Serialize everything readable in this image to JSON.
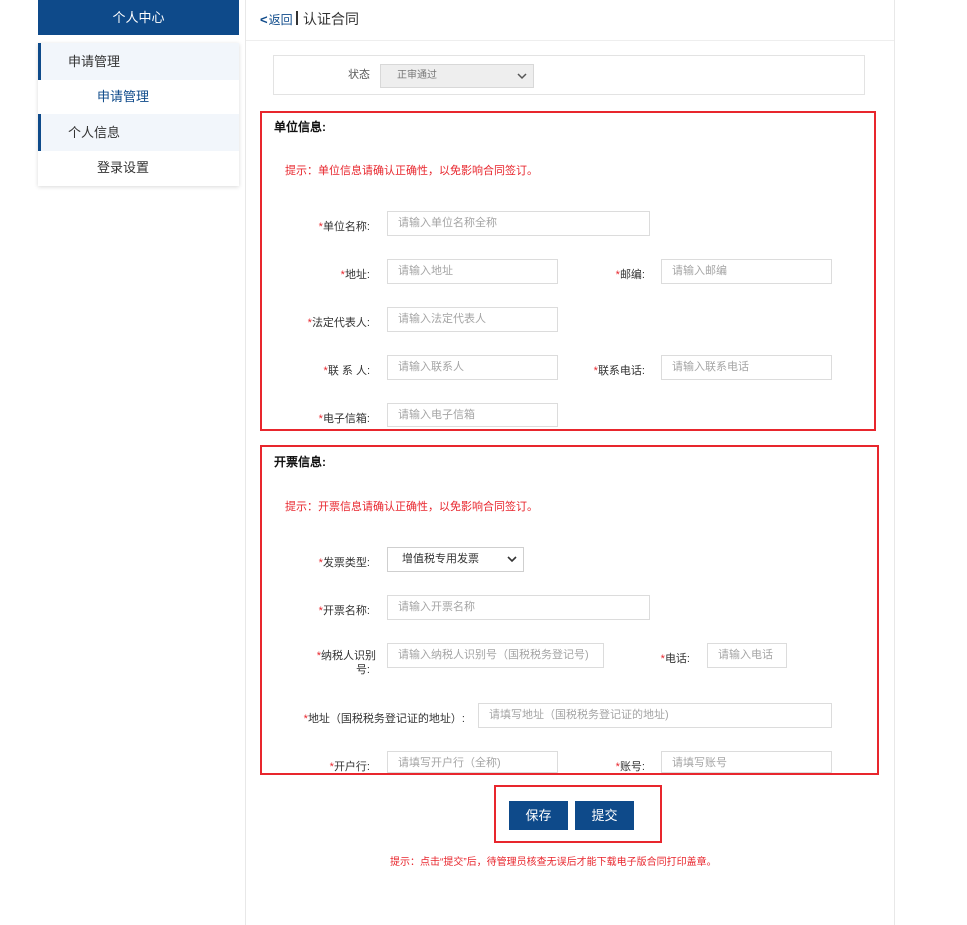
{
  "sidebar": {
    "header": "个人中心",
    "groups": [
      {
        "label": "申请管理",
        "sub": "申请管理"
      },
      {
        "label": "个人信息",
        "sub": "登录设置"
      }
    ]
  },
  "topbar": {
    "back_label": "返回",
    "back_chevron": "<",
    "title": "认证合同"
  },
  "status": {
    "label": "状态",
    "value": "正审通过"
  },
  "unit_section": {
    "title": "单位信息:",
    "hint": "提示：单位信息请确认正确性，以免影响合同签订。",
    "fields": {
      "name": {
        "label": "单位名称:",
        "placeholder": "请输入单位名称全称"
      },
      "address": {
        "label": "地址:",
        "placeholder": "请输入地址"
      },
      "zipcode": {
        "label": "邮编:",
        "placeholder": "请输入邮编"
      },
      "legal_rep": {
        "label": "法定代表人:",
        "placeholder": "请输入法定代表人"
      },
      "contact": {
        "label": "联 系 人:",
        "placeholder": "请输入联系人"
      },
      "contact_phone": {
        "label": "联系电话:",
        "placeholder": "请输入联系电话"
      },
      "email": {
        "label": "电子信箱:",
        "placeholder": "请输入电子信箱"
      }
    }
  },
  "invoice_section": {
    "title": "开票信息:",
    "hint": "提示：开票信息请确认正确性，以免影响合同签订。",
    "fields": {
      "invoice_type": {
        "label": "发票类型:",
        "value": "增值税专用发票"
      },
      "invoice_name": {
        "label": "开票名称:",
        "placeholder": "请输入开票名称"
      },
      "taxpayer_id": {
        "label_line1": "纳税人识别",
        "label_line2": "号:",
        "placeholder": "请输入纳税人识别号（国税税务登记号)"
      },
      "phone": {
        "label": "电话:",
        "placeholder": "请输入电话"
      },
      "reg_address": {
        "label": "地址（国税税务登记证的地址）:",
        "placeholder": "请填写地址（国税税务登记证的地址)"
      },
      "bank": {
        "label": "开户行:",
        "placeholder": "请填写开户行（全称)"
      },
      "account": {
        "label": "账号:",
        "placeholder": "请填写账号"
      }
    }
  },
  "actions": {
    "save": "保存",
    "submit": "提交",
    "footer_hint": "提示：点击“提交”后，待管理员核查无误后才能下载电子版合同打印盖章。"
  },
  "required_mark": "*",
  "colors": {
    "brand": "#0e4a8a",
    "alert": "#e8262d"
  }
}
